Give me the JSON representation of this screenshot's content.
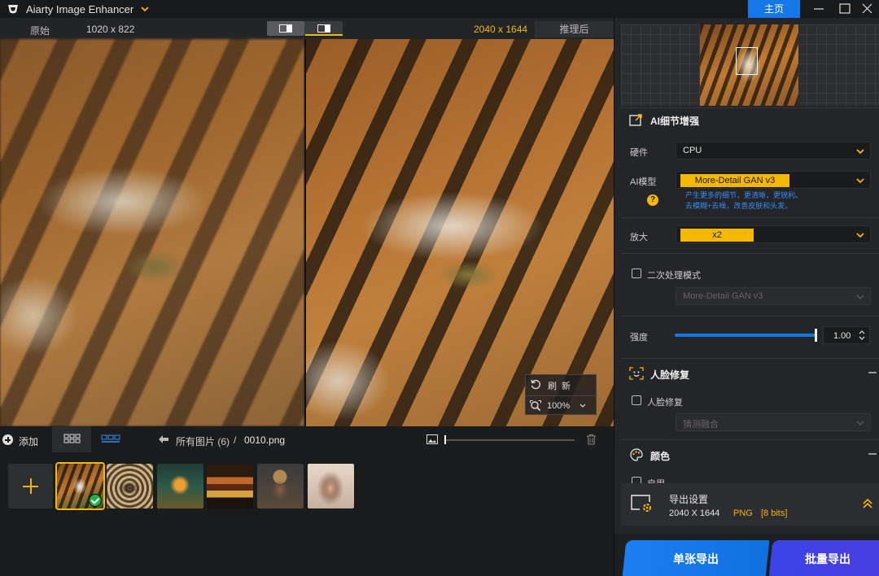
{
  "app": {
    "title": "Aiarty Image Enhancer",
    "home_label": "主页"
  },
  "viewer": {
    "original_label": "原始",
    "original_size": "1020 x 822",
    "output_size": "2040 x 1644",
    "after_label": "推理后",
    "refresh_label": "刷新",
    "zoom": "100%"
  },
  "bottom": {
    "add_label": "添加",
    "breadcrumb_all": "所有图片 (6)",
    "breadcrumb_sep": "/",
    "breadcrumb_file": "0010.png",
    "zoom_level": 0.0
  },
  "thumbnails": [
    {
      "name": "tiger",
      "selected": true
    },
    {
      "name": "butterfly",
      "selected": false
    },
    {
      "name": "fantasy-forest",
      "selected": false
    },
    {
      "name": "burger",
      "selected": false
    },
    {
      "name": "steampunk-dog",
      "selected": false
    },
    {
      "name": "portrait-woman",
      "selected": false
    }
  ],
  "panel": {
    "ai_section_title": "AI细节增强",
    "hardware_label": "硬件",
    "hardware_value": "CPU",
    "model_label": "AI模型",
    "model_value": "More-Detail GAN  v3",
    "model_desc_1": "产生更多的细节，更清晰，更锐利。",
    "model_desc_2": "去模糊+去噪，改善皮肤和头发。",
    "upscale_label": "放大",
    "upscale_value": "x2",
    "second_pass_label": "二次处理模式",
    "second_pass_model": "More-Detail GAN  v3",
    "strength_label": "强度",
    "strength_value": "1.00",
    "face_section_title": "人脸修复",
    "face_check_label": "人脸修复",
    "face_blend_placeholder": "猜测融合",
    "color_section_title": "颜色",
    "color_enable_label": "启用",
    "export_title": "导出设置",
    "export_size": "2040 X 1644",
    "export_format": "PNG",
    "export_bits": "[8 bits]",
    "btn_single": "单张导出",
    "btn_batch": "批量导出"
  },
  "colors": {
    "accent": "#f5b800",
    "primary": "#1677e8",
    "batch": "#3e43e6",
    "ok": "#1db24b"
  }
}
